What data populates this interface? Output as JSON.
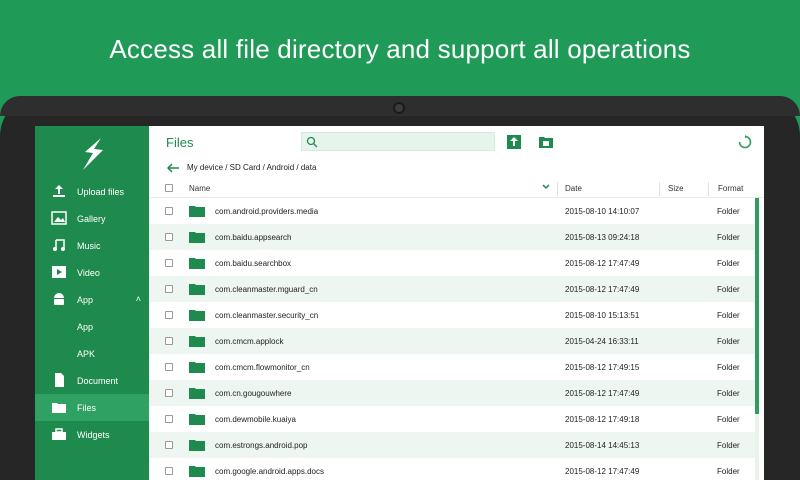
{
  "headline": "Access all file directory and support all operations",
  "colors": {
    "brand": "#1f8a4d",
    "accent": "#2e9d5e",
    "row_alt": "#eef6f1"
  },
  "sidebar": {
    "items": [
      {
        "label": "Upload files",
        "icon": "upload-icon"
      },
      {
        "label": "Gallery",
        "icon": "image-icon"
      },
      {
        "label": "Music",
        "icon": "music-note-icon"
      },
      {
        "label": "Video",
        "icon": "video-play-icon"
      },
      {
        "label": "App",
        "icon": "android-icon",
        "caret": "˄"
      },
      {
        "label": "App",
        "sub": true
      },
      {
        "label": "APK",
        "sub": true
      },
      {
        "label": "Document",
        "icon": "document-icon"
      },
      {
        "label": "Files",
        "icon": "folder-icon",
        "active": true
      },
      {
        "label": "Widgets",
        "icon": "toolbox-icon"
      }
    ]
  },
  "topbar": {
    "title": "Files",
    "search_placeholder": ""
  },
  "breadcrumb": {
    "path": "My device / SD Card / Android / data"
  },
  "table": {
    "columns": {
      "name": "Name",
      "date": "Date",
      "size": "Size",
      "format": "Format"
    },
    "rows": [
      {
        "name": "com.android.providers.media",
        "date": "2015-08-10 14:10:07",
        "format": "Folder"
      },
      {
        "name": "com.baidu.appsearch",
        "date": "2015-08-13 09:24:18",
        "format": "Folder"
      },
      {
        "name": "com.baidu.searchbox",
        "date": "2015-08-12 17:47:49",
        "format": "Folder"
      },
      {
        "name": "com.cleanmaster.mguard_cn",
        "date": "2015-08-12 17:47:49",
        "format": "Folder"
      },
      {
        "name": "com.cleanmaster.security_cn",
        "date": "2015-08-10 15:13:51",
        "format": "Folder"
      },
      {
        "name": "com.cmcm.applock",
        "date": "2015-04-24 16:33:11",
        "format": "Folder"
      },
      {
        "name": "com.cmcm.flowmonitor_cn",
        "date": "2015-08-12 17:49:15",
        "format": "Folder"
      },
      {
        "name": "com.cn.gougouwhere",
        "date": "2015-08-12 17:47:49",
        "format": "Folder"
      },
      {
        "name": "com.dewmobile.kuaiya",
        "date": "2015-08-12 17:49:18",
        "format": "Folder"
      },
      {
        "name": "com.estrongs.android.pop",
        "date": "2015-08-14 14:45:13",
        "format": "Folder"
      },
      {
        "name": "com.google.android.apps.docs",
        "date": "2015-08-12 17:47:49",
        "format": "Folder"
      }
    ]
  }
}
